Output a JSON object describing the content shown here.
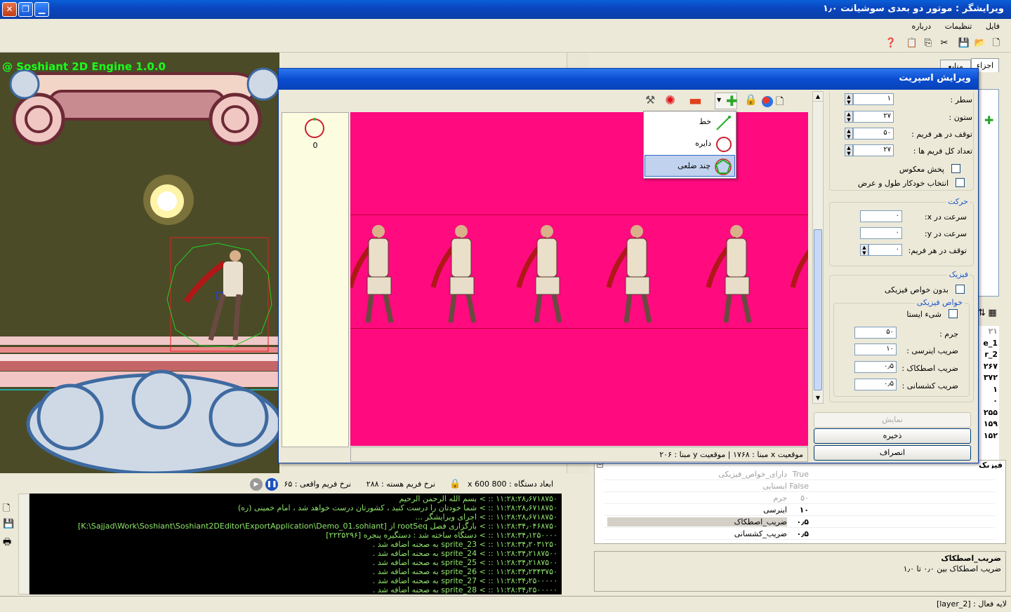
{
  "window": {
    "title": "ویرایشگر : موتور دو بعدی سوشیانت ۱٫۰"
  },
  "menu": [
    "فایل",
    "تنظیمات",
    "درباره"
  ],
  "scene": {
    "overlay_text": "@ Soshiant 2D Engine 1.0.0"
  },
  "right_tabs": [
    "اجزاء",
    "منابع"
  ],
  "side_values": [
    "۲۱",
    "e_1",
    "r_2",
    "۲۶۷",
    "۳۷۲",
    "۱",
    "۰",
    "۲۵۵",
    "۱۵۹",
    "۱۵۲"
  ],
  "dialog": {
    "title": "ویرایش اسپریت",
    "frame_index": "0",
    "status": "موقعیت x مبنا : ۱۷۶۸  |  موقعیت y مبنا : ۲۰۶",
    "shape_menu": [
      {
        "label": "خط",
        "icon": "line-icon"
      },
      {
        "label": "دایره",
        "icon": "circle-icon"
      },
      {
        "label": "چند ضلعی",
        "icon": "polygon-icon",
        "selected": true
      }
    ],
    "props": {
      "row_label": "سطر :",
      "row_value": "۱",
      "col_label": "ستون :",
      "col_value": "۲۷",
      "delay_label": "توقف در هر فریم :",
      "delay_value": "۵۰",
      "total_label": "تعداد کل فریم ها :",
      "total_value": "۲۷",
      "reverse_label": "پخش معکوس",
      "autosize_label": "انتخاب خودکار طول و عرض",
      "move_group": "حرکت",
      "speed_x_label": "سرعت در x:",
      "speed_x_value": "۰",
      "speed_y_label": "سرعت در y:",
      "speed_y_value": "۰",
      "move_delay_label": "توقف در هر فریم:",
      "move_delay_value": "۰",
      "physics_group": "فیزیک",
      "no_physics_label": "بدون خواص فیزیکی",
      "physics_props_group": "خواص فیزیکی",
      "static_label": "شیء ایستا",
      "mass_label": "جرم :",
      "mass_value": "۵۰",
      "inertia_label": "ضریب اینرسی :",
      "inertia_value": "۱۰",
      "friction_label": "ضریب اصطکاک :",
      "friction_value": "۰٫۵",
      "restitution_label": "ضریب کشسانی :",
      "restitution_value": "۰٫۵"
    },
    "buttons": {
      "show": "نمایش",
      "save": "ذخیره",
      "cancel": "انصراف"
    }
  },
  "console_bar": {
    "device_size_label": "ابعاد دستگاه :",
    "device_size": "800 x 600",
    "core_fps_label": "نرخ فریم هسته :",
    "core_fps": "۲۸۸",
    "real_fps_label": "نرخ فریم واقعی :",
    "real_fps": "۶۵"
  },
  "console_lines": [
    "۱۱:۲۸:۲۸٫۶۷۱۸۷۵۰ :: > بسم الله الرحمن الرحیم",
    "۱۱:۲۸:۲۸٫۶۷۱۸۷۵۰ :: > شما خودتان را درست کنید ، کشورتان درست خواهد شد ، امام خمینی (ره)",
    "۱۱:۲۸:۲۸٫۶۷۱۸۷۵۰ :: > اجرای ویرایشگر ...",
    "۱۱:۲۸:۳۴٫۰۴۶۸۷۵۰ :: > بارگزاری فصل rootSeq از [K:\\Sajjad\\Work\\Soshiant\\Soshiant2DEditor\\ExportApplication\\Demo_01.sohiant]",
    "۱۱:۲۸:۳۴٫۱۲۵۰۰۰۰ :: > دستگاه ساخته شد : دستگیره پنجره [۲۲۲۵۲۹۶]",
    "۱۱:۲۸:۳۴٫۲۰۳۱۲۵۰ :: > sprite_23 به صحنه اضافه شد .",
    "۱۱:۲۸:۳۴٫۲۱۸۷۵۰۰ :: > sprite_24 به صحنه اضافه شد .",
    "۱۱:۲۸:۳۴٫۲۱۸۷۵۰۰ :: > sprite_25 به صحنه اضافه شد .",
    "۱۱:۲۸:۳۴٫۲۳۴۳۷۵۰ :: > sprite_26 به صحنه اضافه شد .",
    "۱۱:۲۸:۳۴٫۲۵۰۰۰۰۰ :: > sprite_27 به صحنه اضافه شد .",
    "۱۱:۲۸:۳۴٫۲۵۰۰۰۰۰ :: > sprite_28 به صحنه اضافه شد ."
  ],
  "property_grid": {
    "category": "فیزیک",
    "rows": [
      {
        "name": "دارای_خواص_فیزیکی",
        "value": "True",
        "dim": true
      },
      {
        "name": "ایستایی",
        "value": "False",
        "dim": true
      },
      {
        "name": "جرم",
        "value": "۵۰",
        "dim": true
      },
      {
        "name": "اینرسی",
        "value": "۱۰",
        "dim": false
      },
      {
        "name": "ضریب_اصطکاک",
        "value": "۰٫۵",
        "dim": false,
        "selected": true
      },
      {
        "name": "ضریب_کشسانی",
        "value": "۰٫۵",
        "dim": false
      }
    ]
  },
  "description": {
    "title": "ضریب_اصطکاک",
    "text": "ضریب اصطکاک بین ۰٫۰ تا ۱٫۰"
  },
  "status_bar": {
    "active_layer": "لایه فعال : [layer_2]"
  }
}
